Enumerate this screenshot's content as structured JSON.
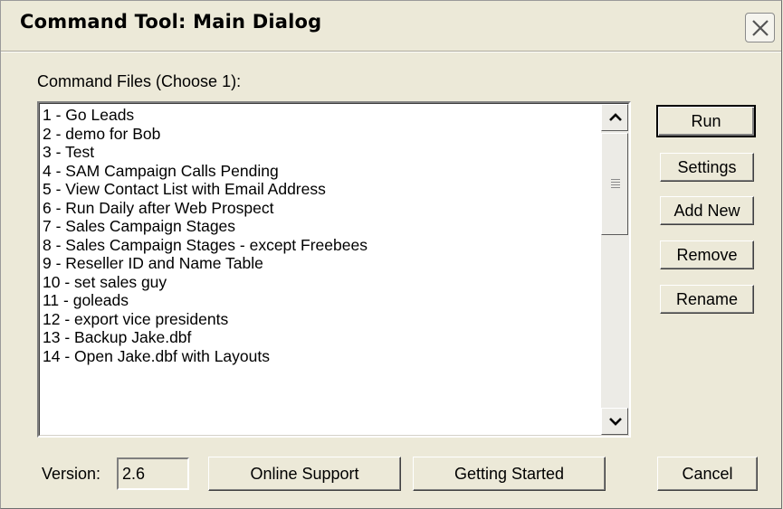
{
  "window": {
    "title": "Command Tool: Main Dialog"
  },
  "command_files": {
    "label": "Command Files (Choose 1):",
    "items": [
      "1 - Go Leads",
      "2 - demo for Bob",
      "3 - Test",
      "4 - SAM Campaign Calls Pending",
      "5 - View Contact List with Email Address",
      "6 - Run Daily after Web Prospect",
      "7 - Sales Campaign Stages",
      "8 - Sales Campaign Stages - except Freebees",
      "9 - Reseller ID and Name Table",
      "10 - set sales guy",
      "11 - goleads",
      "12 - export vice presidents",
      "13 - Backup Jake.dbf",
      "14 - Open Jake.dbf with Layouts"
    ]
  },
  "side_buttons": {
    "run": "Run",
    "settings": "Settings",
    "add_new": "Add New",
    "remove": "Remove",
    "rename": "Rename"
  },
  "footer": {
    "version_label": "Version:",
    "version_value": "2.6",
    "online_support": "Online Support",
    "getting_started": "Getting Started",
    "cancel": "Cancel"
  },
  "icons": {
    "close": "close-icon",
    "scroll_up": "arrow-up-icon",
    "scroll_down": "arrow-down-icon"
  }
}
